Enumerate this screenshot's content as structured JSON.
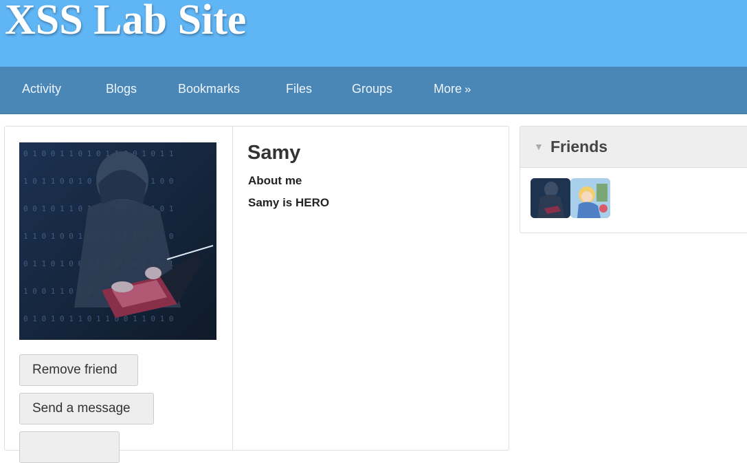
{
  "site": {
    "title": "XSS Lab Site"
  },
  "nav": {
    "items": [
      {
        "label": "Activity"
      },
      {
        "label": "Blogs"
      },
      {
        "label": "Bookmarks"
      },
      {
        "label": "Files"
      },
      {
        "label": "Groups"
      },
      {
        "label": "More",
        "suffix": "»"
      }
    ]
  },
  "profile": {
    "name": "Samy",
    "about_label": "About me",
    "about_text": "Samy is HERO",
    "buttons": {
      "remove_friend": "Remove friend",
      "send_message": "Send a message",
      "third": ""
    }
  },
  "friends": {
    "title": "Friends"
  },
  "colors": {
    "header_bg": "#60b5f5",
    "nav_bg": "#4a87b7"
  }
}
